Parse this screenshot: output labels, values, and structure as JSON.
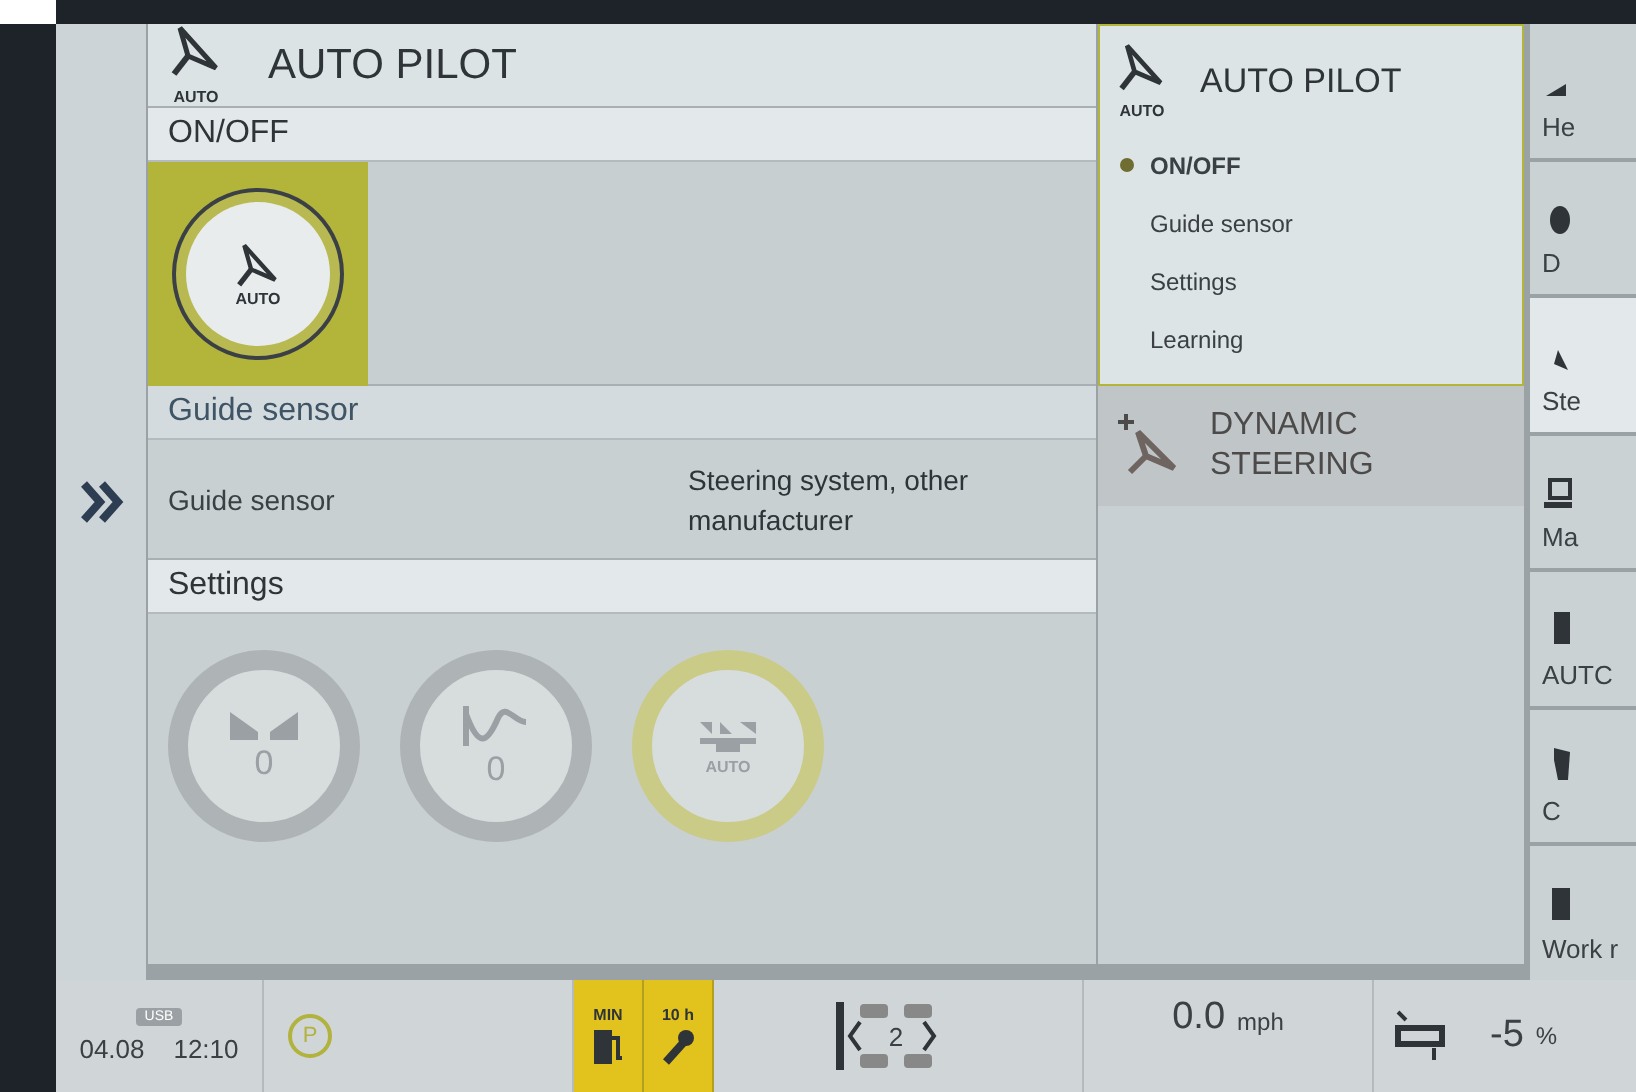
{
  "main": {
    "title": "AUTO PILOT",
    "title_icon_label": "AUTO",
    "onoff": {
      "heading": "ON/OFF",
      "on": true,
      "knob_label": "AUTO"
    },
    "guide": {
      "heading": "Guide sensor",
      "label": "Guide sensor",
      "value": "Steering system, other manufacturer"
    },
    "settings": {
      "heading": "Settings",
      "knobs": [
        {
          "kind": "width",
          "value": "0"
        },
        {
          "kind": "curve",
          "value": "0"
        },
        {
          "kind": "auto",
          "value": "AUTO"
        }
      ]
    }
  },
  "menu": {
    "title": "AUTO PILOT",
    "title_icon_label": "AUTO",
    "items": [
      {
        "label": "ON/OFF",
        "selected": true
      },
      {
        "label": "Guide sensor",
        "selected": false
      },
      {
        "label": "Settings",
        "selected": false
      },
      {
        "label": "Learning",
        "selected": false
      }
    ],
    "next": {
      "title": "DYNAMIC STEERING"
    }
  },
  "nav": [
    {
      "label": "He",
      "kind": "heading",
      "selected": false
    },
    {
      "label": "D",
      "kind": "drive",
      "selected": false
    },
    {
      "label": "Ste",
      "kind": "steer",
      "selected": true
    },
    {
      "label": "Ma",
      "kind": "machine",
      "selected": false
    },
    {
      "label": "AUTC",
      "kind": "auto",
      "selected": false
    },
    {
      "label": "C",
      "kind": "c",
      "selected": false
    },
    {
      "label": "Work r",
      "kind": "work",
      "selected": false
    }
  ],
  "status_bar": {
    "usb": "USB",
    "date": "04.08",
    "time": "12:10",
    "parking": "P",
    "fuel_min": "MIN",
    "service_hours": "10 h",
    "gear": "2",
    "speed": "0.0",
    "speed_unit": "mph",
    "slip": "-5",
    "slip_unit": "%"
  }
}
